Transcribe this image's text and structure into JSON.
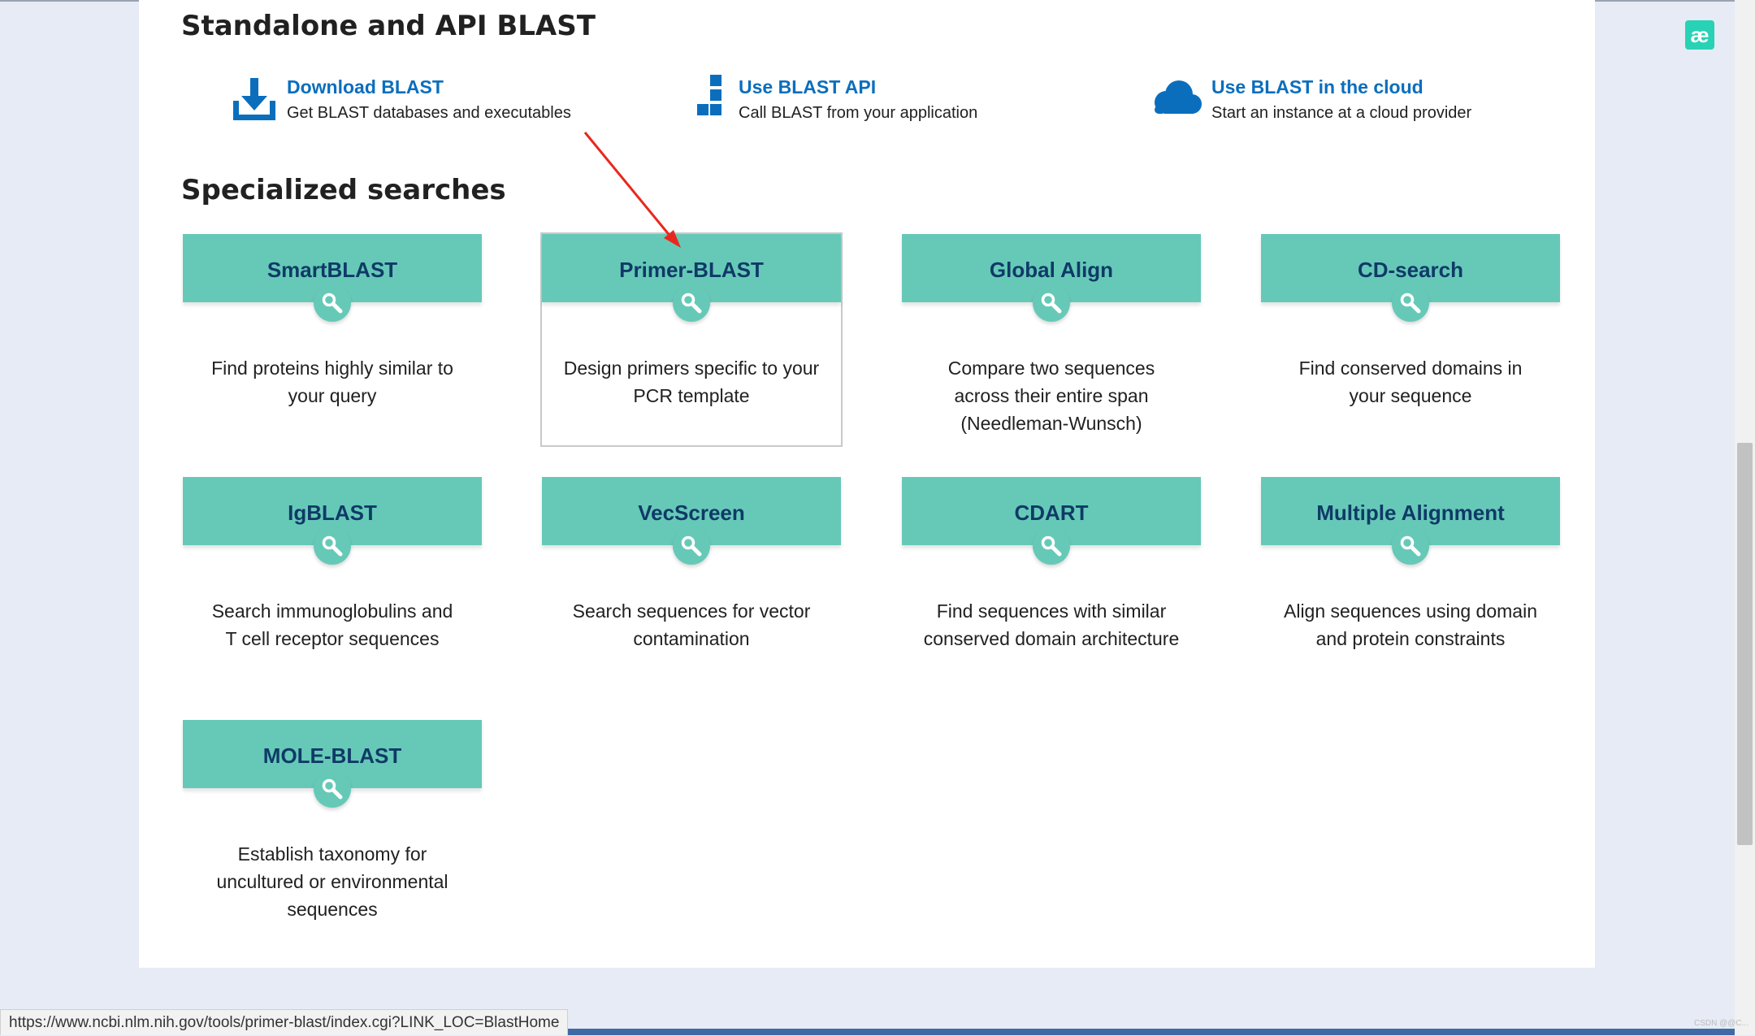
{
  "standalone": {
    "title": "Standalone and API BLAST",
    "items": [
      {
        "label": "Download BLAST",
        "description": "Get BLAST databases and executables",
        "icon": "download-icon"
      },
      {
        "label": "Use BLAST API",
        "description": "Call BLAST from your application",
        "icon": "api-blocks-icon"
      },
      {
        "label": "Use BLAST in the cloud",
        "description": "Start an instance at a cloud provider",
        "icon": "cloud-icon"
      }
    ]
  },
  "specialized": {
    "title": "Specialized searches",
    "cards": [
      {
        "title": "SmartBLAST",
        "description": "Find proteins highly similar to your query"
      },
      {
        "title": "Primer-BLAST",
        "description": "Design primers specific to your PCR template"
      },
      {
        "title": "Global Align",
        "description": "Compare two sequences across their entire span (Needleman-Wunsch)"
      },
      {
        "title": "CD-search",
        "description": "Find conserved domains in your sequence"
      },
      {
        "title": "IgBLAST",
        "description": "Search immunoglobulins and T cell receptor sequences"
      },
      {
        "title": "VecScreen",
        "description": "Search sequences for vector contamination"
      },
      {
        "title": "CDART",
        "description": "Find sequences with similar conserved domain architecture"
      },
      {
        "title": "Multiple Alignment",
        "description": "Align sequences using domain and protein constraints"
      },
      {
        "title": "MOLE-BLAST",
        "description": "Establish taxonomy for uncultured or environmental sequences"
      }
    ]
  },
  "extension_icon": {
    "glyph": "æ"
  },
  "status_bar": {
    "url": "https://www.ncbi.nlm.nih.gov/tools/primer-blast/index.cgi?LINK_LOC=BlastHome"
  },
  "watermark": "CSDN @@C...",
  "colors": {
    "card_header": "#66c9b8",
    "card_title": "#0f3a66",
    "link": "#0b6ebd",
    "page_bg": "#e6ebf5",
    "annotation_arrow": "#e8281e"
  }
}
